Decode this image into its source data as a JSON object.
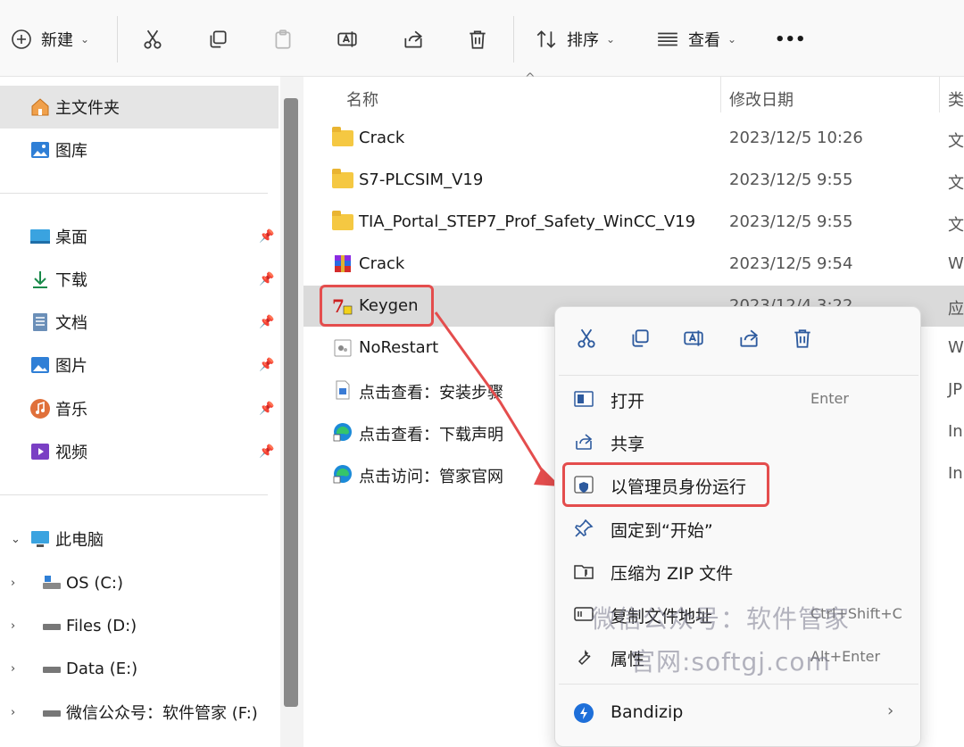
{
  "toolbar": {
    "new_label": "新建",
    "sort_label": "排序",
    "view_label": "查看",
    "more_label": "•••"
  },
  "sidebar": {
    "home": "主文件夹",
    "gallery": "图库",
    "pinned": [
      {
        "label": "桌面",
        "icon": "desktop-icon"
      },
      {
        "label": "下载",
        "icon": "download-icon"
      },
      {
        "label": "文档",
        "icon": "documents-icon"
      },
      {
        "label": "图片",
        "icon": "pictures-icon"
      },
      {
        "label": "音乐",
        "icon": "music-icon"
      },
      {
        "label": "视频",
        "icon": "videos-icon"
      }
    ],
    "pc": "此电脑",
    "drives": [
      {
        "label": "OS (C:)"
      },
      {
        "label": "Files (D:)"
      },
      {
        "label": "Data (E:)"
      },
      {
        "label": "微信公众号：软件管家 (F:)"
      }
    ]
  },
  "columns": {
    "name": "名称",
    "date": "修改日期",
    "type": "类"
  },
  "files": [
    {
      "name": "Crack",
      "date": "2023/12/5 10:26",
      "type": "文"
    },
    {
      "name": "S7-PLCSIM_V19",
      "date": "2023/12/5 9:55",
      "type": "文"
    },
    {
      "name": "TIA_Portal_STEP7_Prof_Safety_WinCC_V19",
      "date": "2023/12/5 9:55",
      "type": "文"
    },
    {
      "name": "Crack",
      "date": "2023/12/5 9:54",
      "type": "W"
    },
    {
      "name": "Keygen",
      "date": "2023/12/4 3:22",
      "type": "应"
    },
    {
      "name": "NoRestart",
      "date": "",
      "type": "W"
    },
    {
      "name": "点击查看：安装步骤",
      "date": "",
      "type": "JP"
    },
    {
      "name": "点击查看：下载声明",
      "date": "",
      "type": "In"
    },
    {
      "name": "点击访问：管家官网",
      "date": "",
      "type": "In"
    }
  ],
  "context_menu": {
    "open": {
      "label": "打开",
      "shortcut": "Enter"
    },
    "share": {
      "label": "共享"
    },
    "run_as_admin": {
      "label": "以管理员身份运行"
    },
    "pin_start": {
      "label": "固定到“开始”"
    },
    "compress_zip": {
      "label": "压缩为 ZIP 文件"
    },
    "copy_path": {
      "label": "复制文件地址",
      "shortcut": "Ctrl+Shift+C"
    },
    "properties": {
      "label": "属性",
      "shortcut": "Alt+Enter"
    },
    "bandizip": {
      "label": "Bandizip"
    }
  },
  "watermark": {
    "line1": "微信公众号：软件管家",
    "line2": "官网:softgj.com"
  },
  "colors": {
    "highlight": "#e44d4d",
    "accent": "#2d5a9e"
  }
}
